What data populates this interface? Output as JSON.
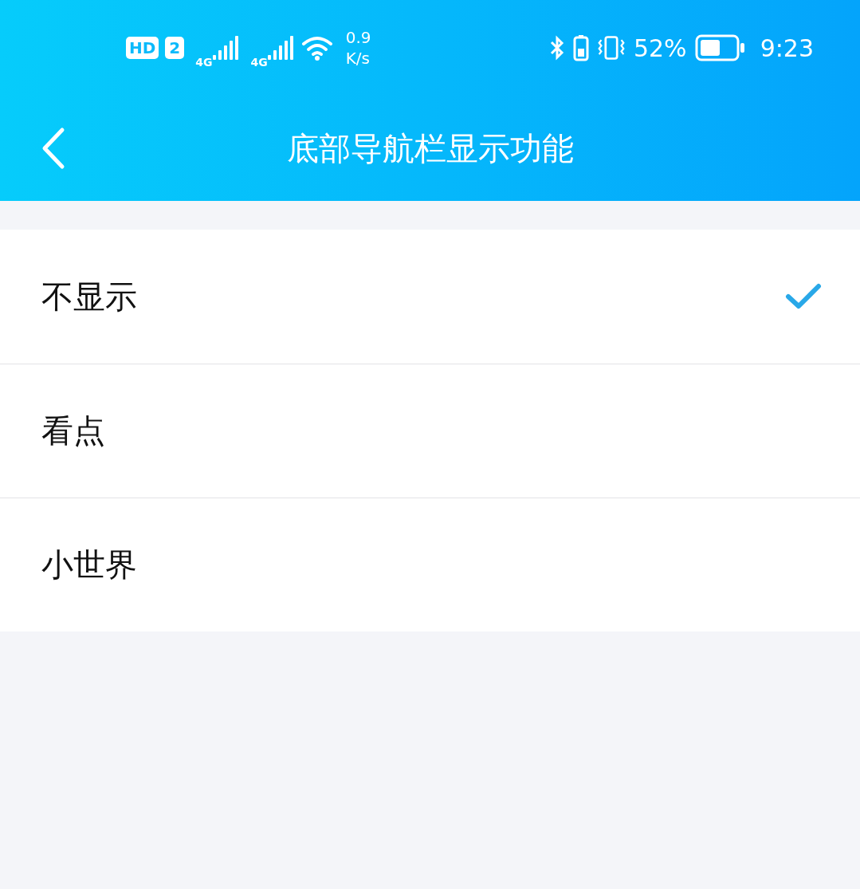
{
  "status_bar": {
    "hd": "HD",
    "sim": "2",
    "network_1": "4G",
    "network_2": "4G",
    "speed_value": "0.9",
    "speed_unit": "K/s",
    "battery_percent": "52%",
    "time": "9:23"
  },
  "header": {
    "title": "底部导航栏显示功能"
  },
  "options": [
    {
      "label": "不显示",
      "selected": true
    },
    {
      "label": "看点",
      "selected": false
    },
    {
      "label": "小世界",
      "selected": false
    }
  ]
}
